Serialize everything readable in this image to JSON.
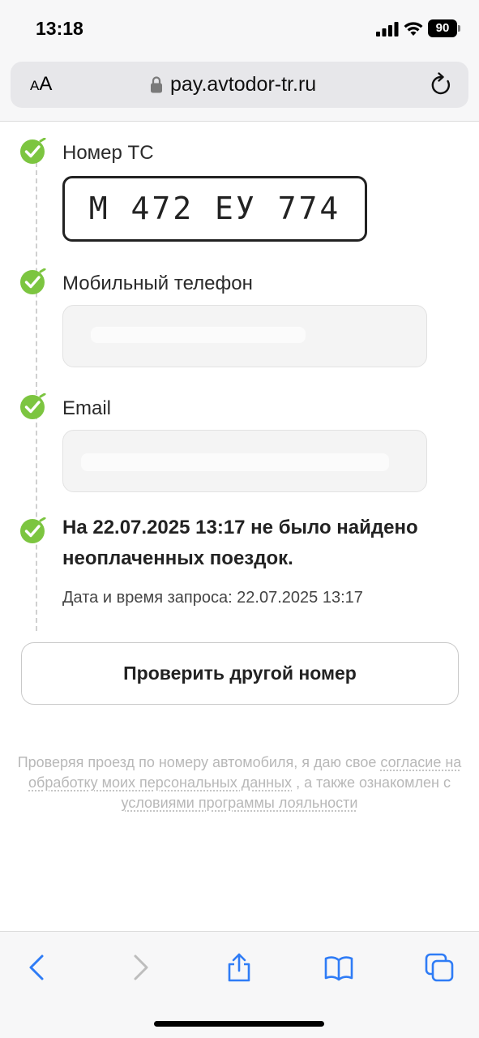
{
  "status_bar": {
    "time": "13:18",
    "battery_level": "90"
  },
  "browser": {
    "text_size_small": "A",
    "text_size_large": "A",
    "url": "pay.avtodor-tr.ru"
  },
  "form": {
    "vehicle_label": "Номер ТС",
    "vehicle_number": "М 472 ЕУ 774",
    "phone_label": "Мобильный телефон",
    "email_label": "Email",
    "result_message": "На 22.07.2025 13:17 не было найдено неоплаченных поездок.",
    "request_datetime": "Дата и время запроса: 22.07.2025 13:17",
    "check_other_button": "Проверить другой номер"
  },
  "consent": {
    "part1": "Проверяя проезд по номеру автомобиля, я даю свое ",
    "link1": "согласие на обработку моих персональных данных",
    "part2": " , а также ознакомлен с ",
    "link2": "условиями программы лояльности"
  },
  "colors": {
    "check_green": "#7cc540",
    "ios_blue": "#2f7cf6",
    "disabled_gray": "#bdbdbd"
  },
  "icons": {
    "status": [
      "signal-icon",
      "wifi-icon",
      "battery-icon"
    ],
    "address_bar": [
      "lock-icon",
      "reload-icon"
    ],
    "toolbar": [
      "back-icon",
      "forward-icon",
      "share-icon",
      "bookmarks-icon",
      "tabs-icon"
    ],
    "steps": "check-circle-icon"
  }
}
